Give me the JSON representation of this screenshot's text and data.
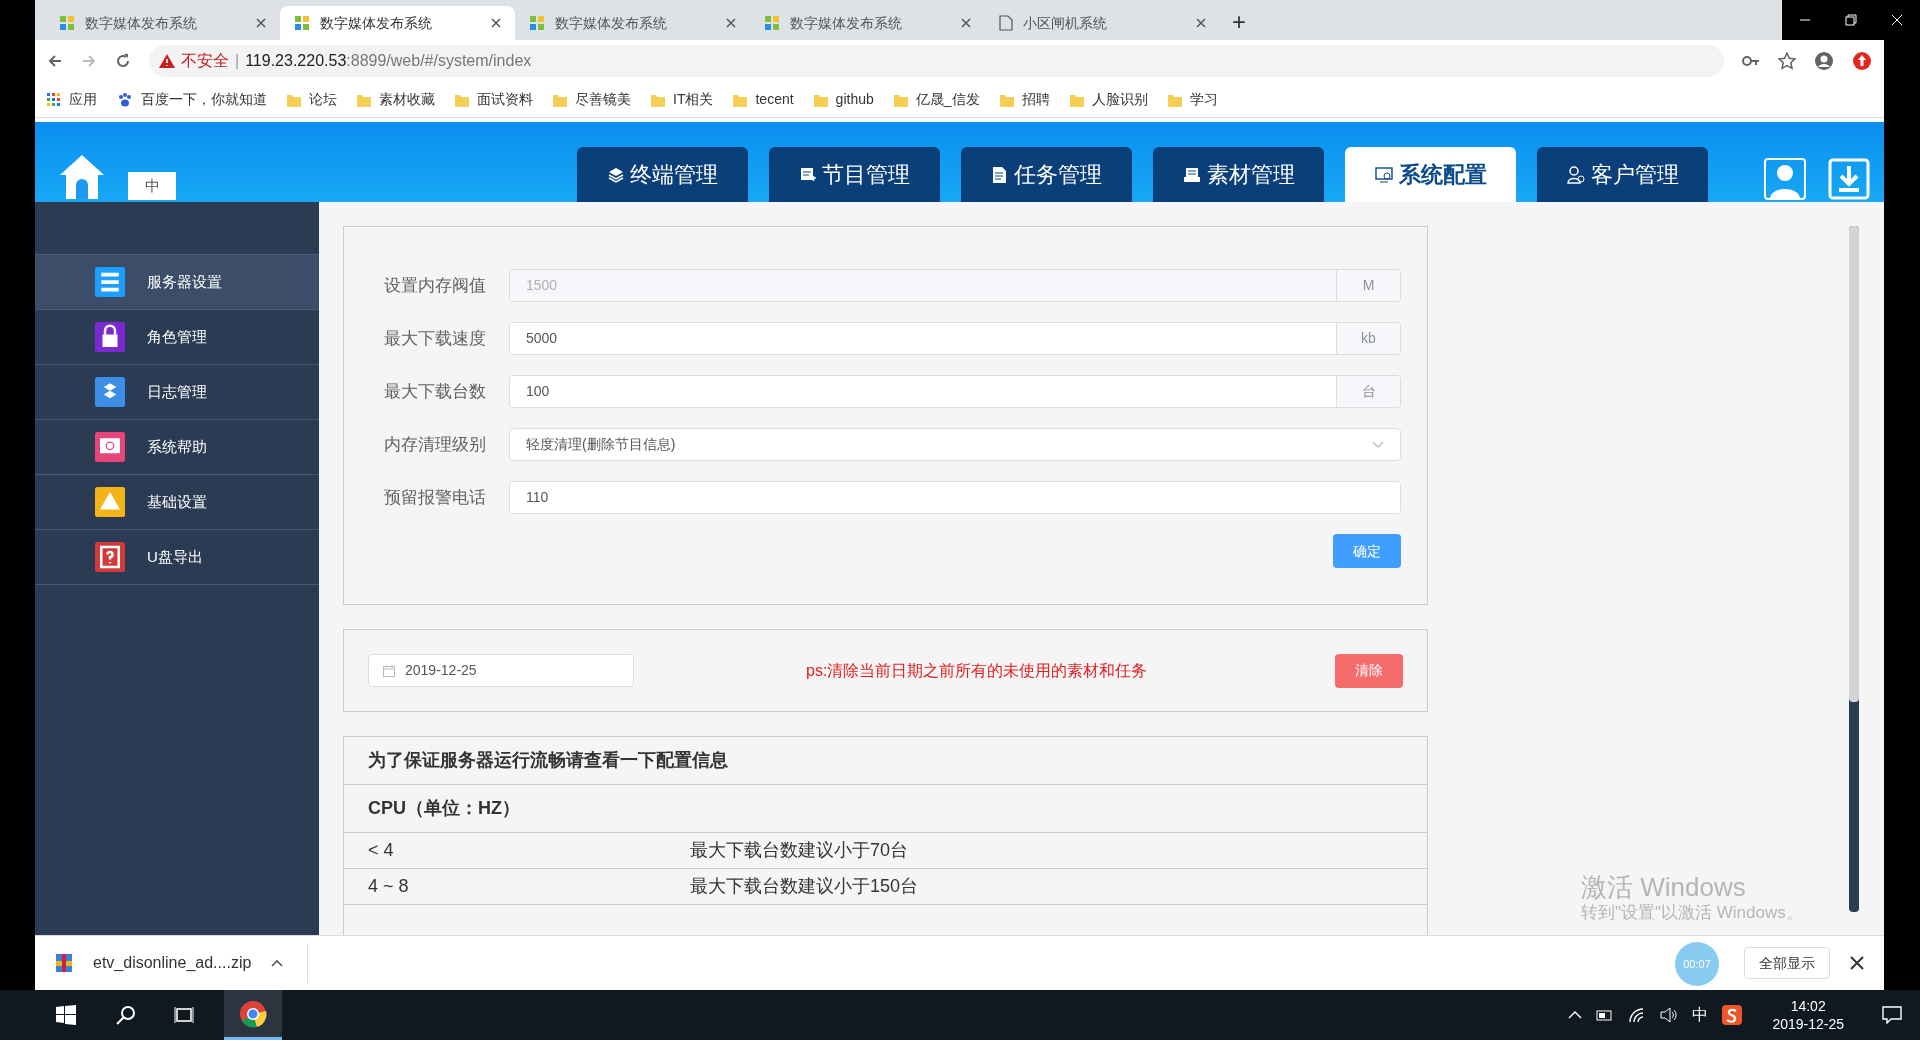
{
  "browser": {
    "tabs": [
      {
        "title": "数字媒体发布系统",
        "selected": false,
        "kind": "app"
      },
      {
        "title": "数字媒体发布系统",
        "selected": true,
        "kind": "app"
      },
      {
        "title": "数字媒体发布系统",
        "selected": false,
        "kind": "app"
      },
      {
        "title": "数字媒体发布系统",
        "selected": false,
        "kind": "app"
      },
      {
        "title": "小区闸机系统",
        "selected": false,
        "kind": "page"
      }
    ],
    "new_tab": "+",
    "address": {
      "warning": "不安全",
      "separator": "|",
      "host": "119.23.220.53",
      "path": ":8899/web/#/system/index"
    },
    "bookmarks": [
      {
        "label": "应用",
        "kind": "apps"
      },
      {
        "label": "百度一下，你就知道",
        "kind": "paw"
      },
      {
        "label": "论坛",
        "kind": "folder"
      },
      {
        "label": "素材收藏",
        "kind": "folder"
      },
      {
        "label": "面试资料",
        "kind": "folder"
      },
      {
        "label": "尽善镜美",
        "kind": "folder"
      },
      {
        "label": "IT相关",
        "kind": "folder"
      },
      {
        "label": "tecent",
        "kind": "folder"
      },
      {
        "label": "github",
        "kind": "folder"
      },
      {
        "label": "亿晟_信发",
        "kind": "folder"
      },
      {
        "label": "招聘",
        "kind": "folder"
      },
      {
        "label": "人脸识别",
        "kind": "folder"
      },
      {
        "label": "学习",
        "kind": "folder"
      }
    ]
  },
  "header": {
    "language": {
      "label": "中",
      "selected": true
    },
    "nav": [
      {
        "label": "终端管理",
        "selected": false
      },
      {
        "label": "节目管理",
        "selected": false
      },
      {
        "label": "任务管理",
        "selected": false
      },
      {
        "label": "素材管理",
        "selected": false
      },
      {
        "label": "系统配置",
        "selected": true
      },
      {
        "label": "客户管理",
        "selected": false
      }
    ]
  },
  "sidebar": {
    "items": [
      {
        "label": "服务器设置",
        "selected": true,
        "color": "#1e9fff"
      },
      {
        "label": "角色管理",
        "selected": false,
        "color": "#7b2ad1"
      },
      {
        "label": "日志管理",
        "selected": false,
        "color": "#3d8fe6"
      },
      {
        "label": "系统帮助",
        "selected": false,
        "color": "#e8457a"
      },
      {
        "label": "基础设置",
        "selected": false,
        "color": "#f5b31a"
      },
      {
        "label": "U盘导出",
        "selected": false,
        "color": "#d23a3a"
      }
    ]
  },
  "settings_form": {
    "fields": [
      {
        "label": "设置内存阀值",
        "value": "1500",
        "unit": "M",
        "kind": "input",
        "disabled": true
      },
      {
        "label": "最大下载速度",
        "value": "5000",
        "unit": "kb",
        "kind": "input",
        "disabled": false
      },
      {
        "label": "最大下载台数",
        "value": "100",
        "unit": "台",
        "kind": "input",
        "disabled": false
      },
      {
        "label": "内存清理级别",
        "value": "轻度清理(删除节目信息)",
        "kind": "select",
        "disabled": false
      },
      {
        "label": "预留报警电话",
        "value": "110",
        "kind": "input",
        "disabled": false
      }
    ],
    "confirm": "确定"
  },
  "cleanup": {
    "date": "2019-12-25",
    "note": "ps:清除当前日期之前所有的未使用的素材和任务",
    "button": "清除"
  },
  "config_info": {
    "title": "为了保证服务器运行流畅请查看一下配置信息",
    "section": "CPU（单位：HZ）",
    "rows": [
      {
        "range": "< 4",
        "advice": "最大下载台数建议小于70台"
      },
      {
        "range": "4 ~ 8",
        "advice": "最大下载台数建议小于150台"
      }
    ]
  },
  "download_bar": {
    "file": "etv_disonline_ad....zip",
    "show_all": "全部显示",
    "recorder": "00:07"
  },
  "activation": {
    "title": "激活 Windows",
    "hint": "转到\"设置\"以激活 Windows。"
  },
  "taskbar": {
    "ime": "中",
    "time": "14:02",
    "date": "2019-12-25"
  }
}
